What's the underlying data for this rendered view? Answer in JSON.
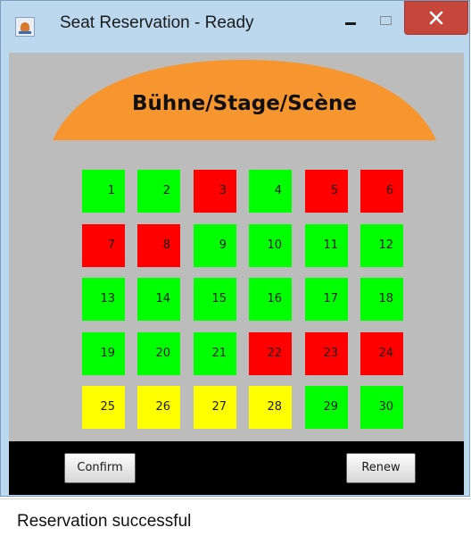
{
  "window": {
    "title": "Seat Reservation - Ready",
    "icon": "java-cup-icon",
    "controls": [
      "minimize-icon",
      "maximize-icon",
      "close-icon"
    ]
  },
  "stage": {
    "label": "Bühne/Stage/Scène",
    "color": "#f7952f"
  },
  "seat_colors": {
    "free": "#00ff00",
    "reserved": "#ff0000",
    "selected": "#ffff00"
  },
  "seats": [
    {
      "number": "1",
      "state": "free"
    },
    {
      "number": "2",
      "state": "free"
    },
    {
      "number": "3",
      "state": "reserved"
    },
    {
      "number": "4",
      "state": "free"
    },
    {
      "number": "5",
      "state": "reserved"
    },
    {
      "number": "6",
      "state": "reserved"
    },
    {
      "number": "7",
      "state": "reserved"
    },
    {
      "number": "8",
      "state": "reserved"
    },
    {
      "number": "9",
      "state": "free"
    },
    {
      "number": "10",
      "state": "free"
    },
    {
      "number": "11",
      "state": "free"
    },
    {
      "number": "12",
      "state": "free"
    },
    {
      "number": "13",
      "state": "free"
    },
    {
      "number": "14",
      "state": "free"
    },
    {
      "number": "15",
      "state": "free"
    },
    {
      "number": "16",
      "state": "free"
    },
    {
      "number": "17",
      "state": "free"
    },
    {
      "number": "18",
      "state": "free"
    },
    {
      "number": "19",
      "state": "free"
    },
    {
      "number": "20",
      "state": "free"
    },
    {
      "number": "21",
      "state": "free"
    },
    {
      "number": "22",
      "state": "reserved"
    },
    {
      "number": "23",
      "state": "reserved"
    },
    {
      "number": "24",
      "state": "reserved"
    },
    {
      "number": "25",
      "state": "selected"
    },
    {
      "number": "26",
      "state": "selected"
    },
    {
      "number": "27",
      "state": "selected"
    },
    {
      "number": "28",
      "state": "selected"
    },
    {
      "number": "29",
      "state": "free"
    },
    {
      "number": "30",
      "state": "free"
    }
  ],
  "buttons": {
    "confirm_label": "Confirm",
    "renew_label": "Renew"
  },
  "status": {
    "message": "Reservation successful"
  }
}
